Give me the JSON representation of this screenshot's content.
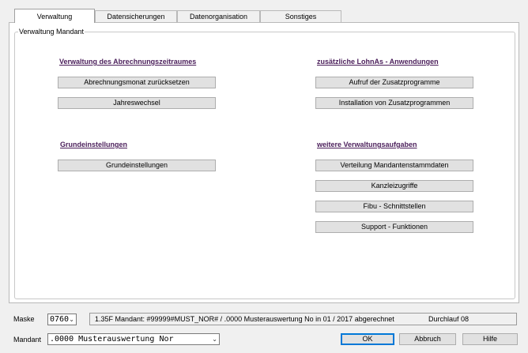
{
  "tabs": [
    {
      "label": "Verwaltung",
      "active": true
    },
    {
      "label": "Datensicherungen",
      "active": false
    },
    {
      "label": "Datenorganisation",
      "active": false
    },
    {
      "label": "Sonstiges",
      "active": false
    }
  ],
  "group": {
    "title": "Verwaltung Mandant"
  },
  "sections": {
    "abrechnung": {
      "title": "Verwaltung des Abrechnungszeitraumes",
      "buttons": [
        "Abrechnungsmonat zurücksetzen",
        "Jahreswechsel"
      ]
    },
    "lohnas": {
      "title": "zusätzliche LohnAs - Anwendungen",
      "buttons": [
        "Aufruf der Zusatzprogramme",
        "Installation von Zusatzprogrammen"
      ]
    },
    "grund": {
      "title": "Grundeinstellungen",
      "buttons": [
        "Grundeinstellungen"
      ]
    },
    "weitere": {
      "title": "weitere Verwaltungsaufgaben",
      "buttons": [
        "Verteilung Mandantenstammdaten",
        "Kanzleizugriffe",
        "Fibu - Schnittstellen",
        "Support - Funktionen"
      ]
    }
  },
  "bottom": {
    "maske_label": "Maske",
    "maske_value": "0760",
    "status_text": "1.35F Mandant: #99999#MUST_NOR# / .0000 Musterauswertung No in 01 / 2017 abgerechnet",
    "status_run": "Durchlauf 08",
    "mandant_label": "Mandant",
    "mandant_value": ".0000 Musterauswertung Nor",
    "ok_label": "OK",
    "cancel_label": "Abbruch",
    "help_label": "Hilfe"
  },
  "colors": {
    "section_title": "#4a1e5a",
    "default_button_border": "#0078d7"
  }
}
